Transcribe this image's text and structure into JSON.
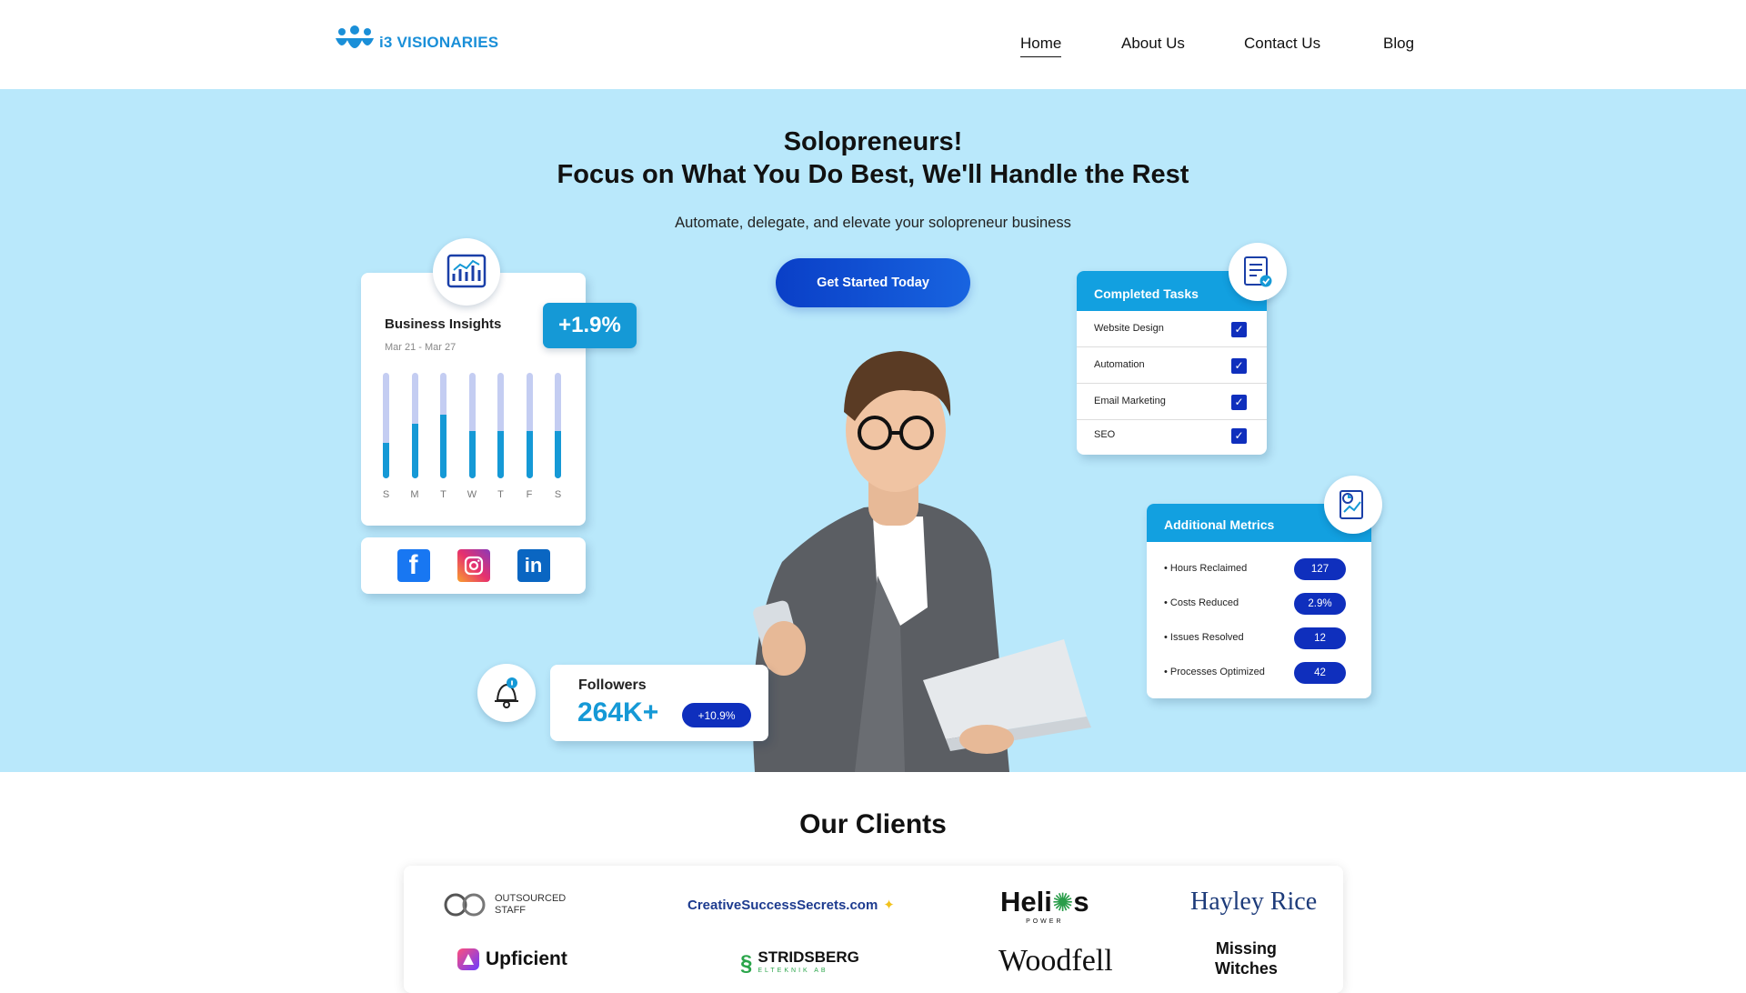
{
  "brand": {
    "name": "i3 VISIONARIES"
  },
  "nav": {
    "items": [
      "Home",
      "About Us",
      "Contact Us",
      "Blog"
    ],
    "active": "Home"
  },
  "hero": {
    "title_line1": "Solopreneurs!",
    "title_line2": "Focus on What You Do Best, We'll Handle the Rest",
    "subtitle": "Automate, delegate, and elevate your solopreneur business",
    "cta": "Get Started Today"
  },
  "insights": {
    "title": "Business Insights",
    "date_range": "Mar 21 - Mar 27",
    "growth": "+1.9%",
    "days": [
      "S",
      "M",
      "T",
      "W",
      "T",
      "F",
      "S"
    ],
    "levels": [
      0.34,
      0.52,
      0.6,
      0.45,
      0.45,
      0.45,
      0.45
    ]
  },
  "social": {
    "icons": [
      "facebook-icon",
      "instagram-icon",
      "linkedin-icon"
    ]
  },
  "completed_tasks": {
    "title": "Completed Tasks",
    "items": [
      "Website Design",
      "Automation",
      "Email Marketing",
      "SEO"
    ]
  },
  "metrics": {
    "title": "Additional Metrics",
    "items": [
      {
        "label": "Hours Reclaimed",
        "value": "127"
      },
      {
        "label": "Costs Reduced",
        "value": "2.9%"
      },
      {
        "label": "Issues Resolved",
        "value": "12"
      },
      {
        "label": "Processes Optimized",
        "value": "42"
      }
    ]
  },
  "followers": {
    "label": "Followers",
    "count": "264K+",
    "change": "+10.9%"
  },
  "clients": {
    "title": "Our Clients",
    "logos": {
      "outsourced": "OUTSOURCED",
      "outsourced2": "STAFF",
      "creative": "CreativeSuccessSecrets.com",
      "helios": "Heli",
      "helios2": "s",
      "helios_sub": "POWER",
      "hayley": "Hayley Rice",
      "upficient": "Upficient",
      "stridsberg": "STRIDSBERG",
      "stridsberg_sub": "ELTEKNIK AB",
      "woodfell": "Woodfell",
      "missing1": "Missing",
      "missing2": "Witches"
    }
  },
  "colors": {
    "hero_bg": "#b9e8fb",
    "accent": "#1599d6",
    "navy": "#0f2fbd"
  }
}
